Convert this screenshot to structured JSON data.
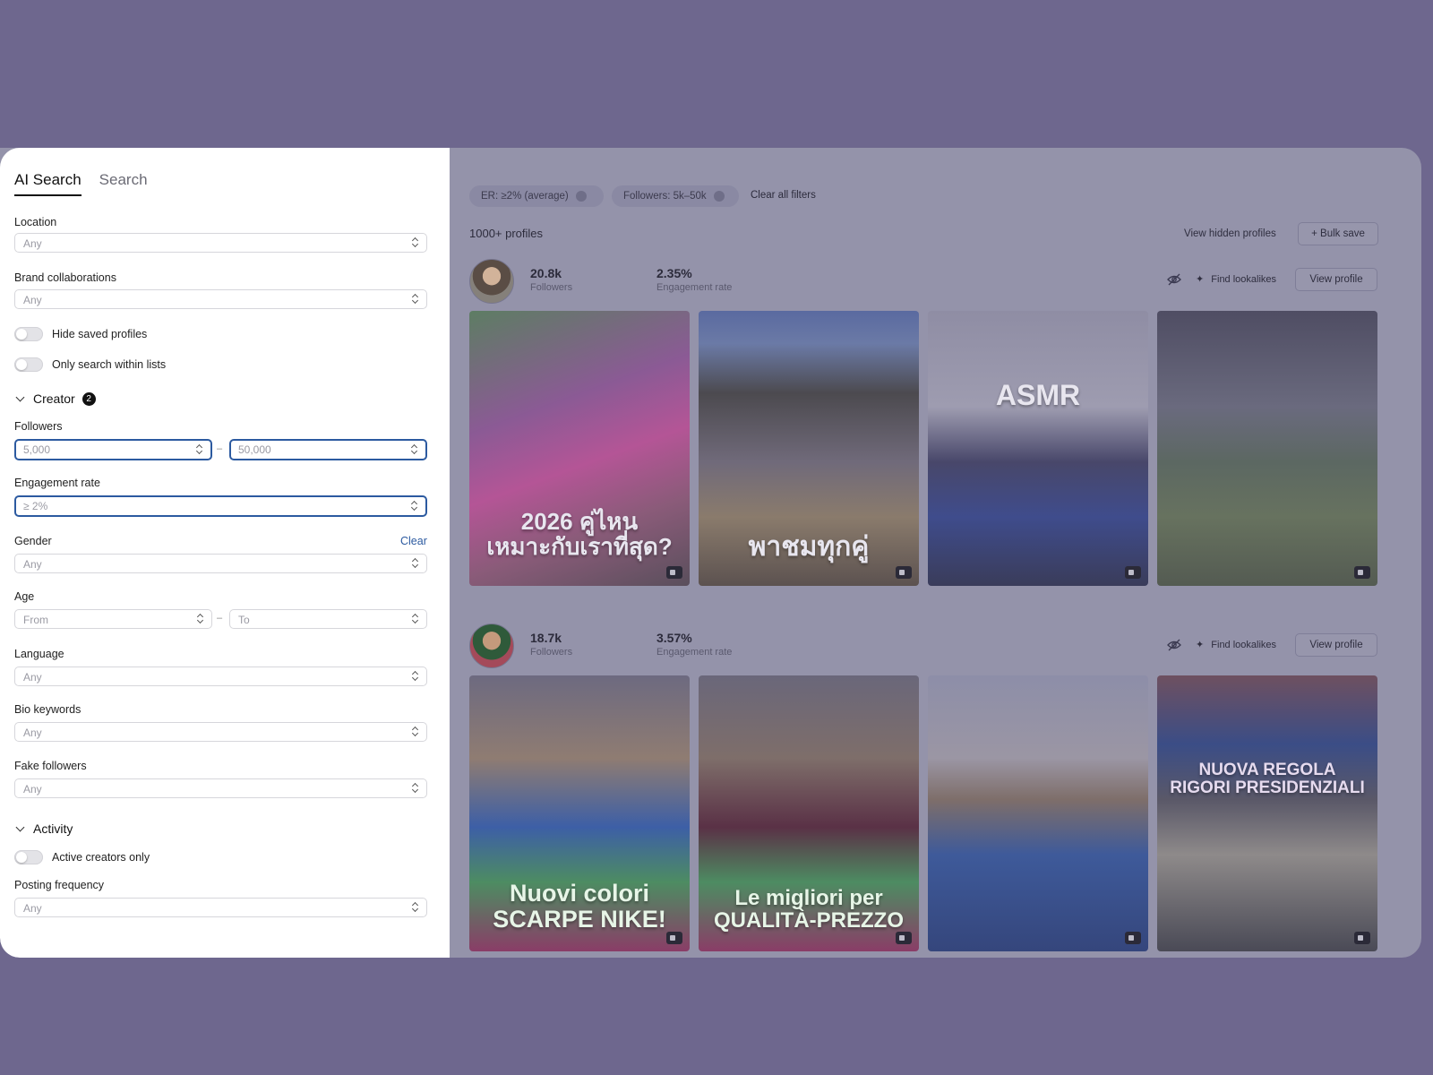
{
  "tabs": [
    {
      "label": "AI Search",
      "active": true
    },
    {
      "label": "Search",
      "active": false
    }
  ],
  "filters": {
    "location": {
      "label": "Location",
      "placeholder": "Any"
    },
    "brand_collaborations": {
      "label": "Brand collaborations",
      "placeholder": "Any"
    },
    "hide_saved": {
      "label": "Hide saved profiles",
      "on": false
    },
    "only_lists": {
      "label": "Only search within lists",
      "on": false
    },
    "creator_section": {
      "label": "Creator",
      "badge": "2"
    },
    "followers": {
      "label": "Followers",
      "min": "5,000",
      "max": "50,000",
      "separator": "–"
    },
    "engagement_rate": {
      "label": "Engagement rate",
      "value": "≥ 2%"
    },
    "gender": {
      "label": "Gender",
      "placeholder": "Any",
      "clear_label": "Clear"
    },
    "age": {
      "label": "Age",
      "from": "From",
      "to": "To",
      "separator": "–"
    },
    "language": {
      "label": "Language",
      "placeholder": "Any"
    },
    "bio_keywords": {
      "label": "Bio keywords",
      "placeholder": "Any"
    },
    "fake_followers": {
      "label": "Fake followers",
      "placeholder": "Any"
    },
    "activity_section": {
      "label": "Activity"
    },
    "active_only": {
      "label": "Active creators only",
      "on": false
    },
    "posting_frequency": {
      "label": "Posting frequency",
      "placeholder": "Any"
    }
  },
  "active_filters": [
    {
      "label": "ER: ≥2% (average)"
    },
    {
      "label": "Followers: 5k–50k"
    }
  ],
  "clear_all_label": "Clear all filters",
  "results_count": "1000+ profiles",
  "view_hidden_label": "View hidden profiles",
  "bulk_save_label": "+ Bulk save",
  "profiles": [
    {
      "followers": "20.8k",
      "followers_label": "Followers",
      "engagement": "2.35%",
      "engagement_label": "Engagement rate",
      "lookalikes_label": "Find lookalikes",
      "view_label": "View profile",
      "posts": [
        {
          "caption": "2026 คู่ไหน\nเหมาะกับเราที่สุด?",
          "icon": "video-icon"
        },
        {
          "caption": "พาชมทุกคู่",
          "icon": "video-icon"
        },
        {
          "caption": "ASMR",
          "icon": "video-icon"
        },
        {
          "caption": "",
          "icon": "video-icon"
        }
      ]
    },
    {
      "followers": "18.7k",
      "followers_label": "Followers",
      "engagement": "3.57%",
      "engagement_label": "Engagement rate",
      "lookalikes_label": "Find lookalikes",
      "view_label": "View profile",
      "posts": [
        {
          "caption": "Nuovi colori\nSCARPE NIKE!",
          "icon": "video-icon"
        },
        {
          "caption": "Le migliori per\nQUALITÀ-PREZZO",
          "icon": "video-icon"
        },
        {
          "caption": "",
          "icon": "video-icon"
        },
        {
          "caption": "NUOVA REGOLA\nRIGORI PRESIDENZIALI",
          "icon": "video-icon"
        }
      ]
    }
  ],
  "colors": {
    "accent": "#2c5aa0",
    "backdrop": "#6e678e",
    "overlay": "#9493aa"
  }
}
